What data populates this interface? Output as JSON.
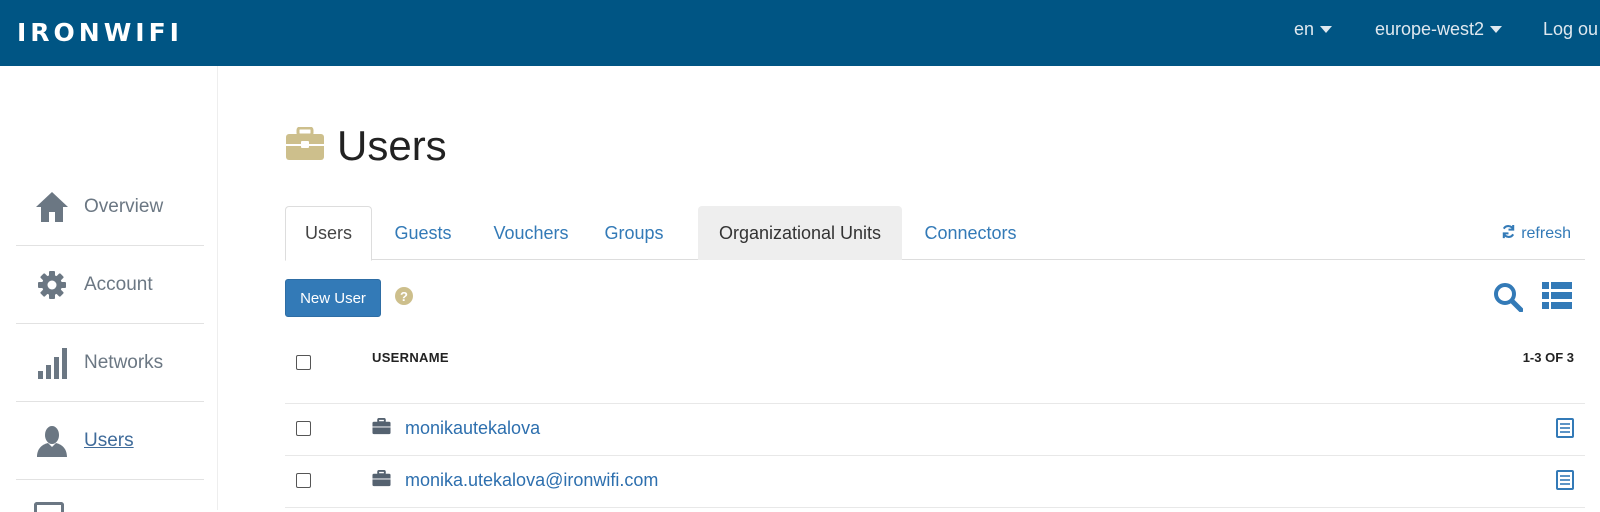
{
  "header": {
    "logo": "IRONWIFI",
    "language": "en",
    "region": "europe-west2",
    "logout": "Log ou"
  },
  "sidebar": {
    "items": [
      {
        "label": "Overview",
        "icon": "home-icon"
      },
      {
        "label": "Account",
        "icon": "gear-icon"
      },
      {
        "label": "Networks",
        "icon": "signal-bars-icon"
      },
      {
        "label": "Users",
        "icon": "user-icon",
        "active": true
      }
    ]
  },
  "page": {
    "title": "Users",
    "title_icon": "briefcase-icon"
  },
  "tabs": [
    {
      "label": "Users",
      "state": "active"
    },
    {
      "label": "Guests"
    },
    {
      "label": "Vouchers"
    },
    {
      "label": "Groups"
    },
    {
      "label": "Organizational Units",
      "state": "hover"
    },
    {
      "label": "Connectors"
    }
  ],
  "toolbar": {
    "refresh_label": "refresh",
    "new_user_label": "New User",
    "help_glyph": "?"
  },
  "table": {
    "header_username": "USERNAME",
    "count_label": "1-3 OF 3",
    "rows": [
      {
        "username": "monikautekalova"
      },
      {
        "username": "monika.utekalova@ironwifi.com"
      }
    ]
  },
  "colors": {
    "topbar": "#005584",
    "accent": "#337ab7",
    "title_icon": "#cdbf8c"
  }
}
